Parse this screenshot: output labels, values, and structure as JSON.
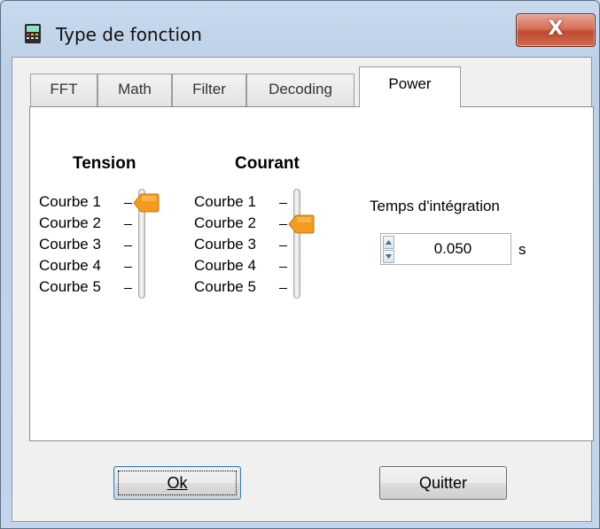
{
  "window": {
    "title": "Type de fonction",
    "close_glyph": "X",
    "icon": "app-icon"
  },
  "tabs": [
    {
      "label": "FFT"
    },
    {
      "label": "Math"
    },
    {
      "label": "Filter"
    },
    {
      "label": "Decoding"
    },
    {
      "label": "Power",
      "active": true
    }
  ],
  "tension": {
    "heading": "Tension",
    "options": [
      "Courbe 1",
      "Courbe 2",
      "Courbe 3",
      "Courbe 4",
      "Courbe 5"
    ],
    "selected_index": 0
  },
  "courant": {
    "heading": "Courant",
    "options": [
      "Courbe 1",
      "Courbe 2",
      "Courbe 3",
      "Courbe 4",
      "Courbe 5"
    ],
    "selected_index": 1
  },
  "integration": {
    "label": "Temps d'intégration",
    "value": "0.050",
    "unit": "s"
  },
  "buttons": {
    "ok": "Ok",
    "quit": "Quitter"
  },
  "colors": {
    "thumb": "#f59a1c",
    "close_button": "#c8563c",
    "client_bg": "#f0f0f0"
  }
}
